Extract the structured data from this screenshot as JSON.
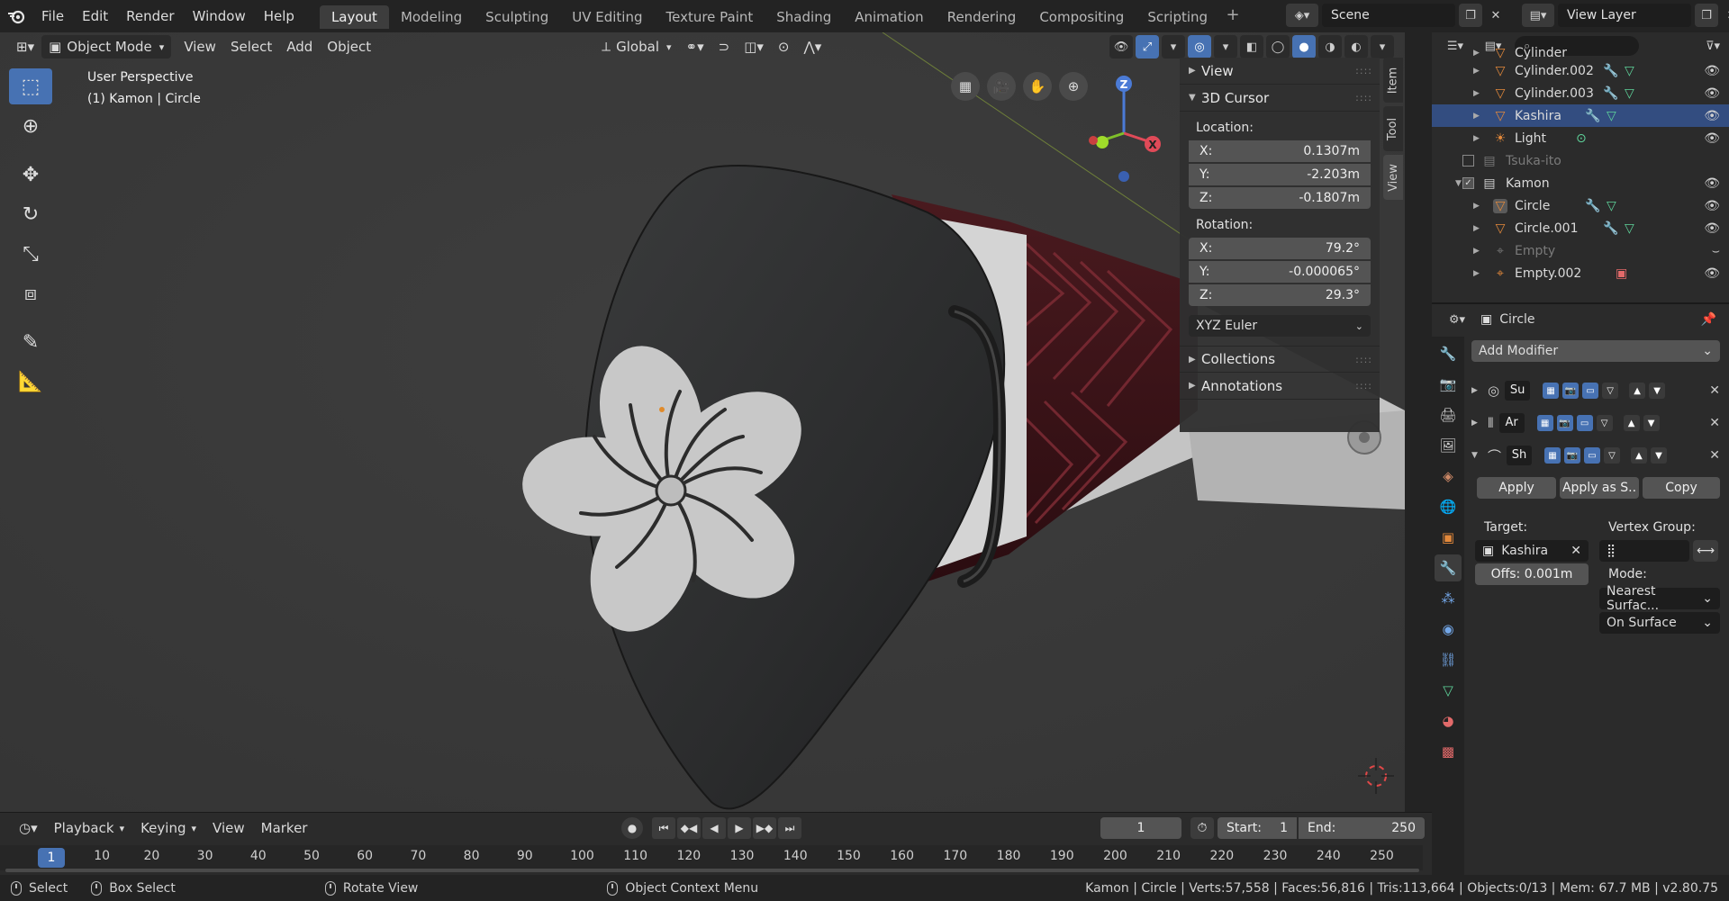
{
  "menu": {
    "items": [
      "File",
      "Edit",
      "Render",
      "Window",
      "Help"
    ]
  },
  "workspaces": {
    "tabs": [
      "Layout",
      "Modeling",
      "Sculpting",
      "UV Editing",
      "Texture Paint",
      "Shading",
      "Animation",
      "Rendering",
      "Compositing",
      "Scripting"
    ],
    "active": "Layout",
    "add_label": "+"
  },
  "scene": {
    "name": "Scene"
  },
  "view_layer": {
    "name": "View Layer"
  },
  "viewport": {
    "mode": "Object Mode",
    "menus": [
      "View",
      "Select",
      "Add",
      "Object"
    ],
    "orientation": "Global",
    "info_line1": "User Perspective",
    "info_line2": "(1) Kamon | Circle"
  },
  "npanel": {
    "view_label": "View",
    "cursor_label": "3D Cursor",
    "location_label": "Location:",
    "location": {
      "x": "0.1307m",
      "y": "-2.203m",
      "z": "-0.1807m"
    },
    "rotation_label": "Rotation:",
    "rotation": {
      "x": "79.2°",
      "y": "-0.000065°",
      "z": "29.3°"
    },
    "rotation_mode": "XYZ Euler",
    "collections_label": "Collections",
    "annotations_label": "Annotations",
    "axis_x": "X:",
    "axis_y": "Y:",
    "axis_z": "Z:",
    "tabs": [
      "Item",
      "Tool",
      "View"
    ]
  },
  "timeline": {
    "menus": [
      "Playback",
      "Keying",
      "View",
      "Marker"
    ],
    "current_frame": "1",
    "start_label": "Start:",
    "start": "1",
    "end_label": "End:",
    "end": "250",
    "ticks": [
      "1",
      "10",
      "20",
      "30",
      "40",
      "50",
      "60",
      "70",
      "80",
      "90",
      "100",
      "110",
      "120",
      "130",
      "140",
      "150",
      "160",
      "170",
      "180",
      "190",
      "200",
      "210",
      "220",
      "230",
      "240",
      "250"
    ]
  },
  "status": {
    "select": "Select",
    "box_select": "Box Select",
    "rotate_view": "Rotate View",
    "context_menu": "Object Context Menu",
    "stats": "Kamon | Circle | Verts:57,558 | Faces:56,816 | Tris:113,664 | Objects:0/13 | Mem: 67.7 MB | v2.80.75"
  },
  "outliner": {
    "search_placeholder": "",
    "rows": [
      {
        "name": "Cylinder",
        "type": "mesh",
        "indent": 2,
        "state": "cut"
      },
      {
        "name": "Cylinder.002",
        "type": "mesh",
        "indent": 2,
        "state": "normal"
      },
      {
        "name": "Cylinder.003",
        "type": "mesh",
        "indent": 2,
        "state": "normal"
      },
      {
        "name": "Kashira",
        "type": "mesh",
        "indent": 2,
        "state": "selected"
      },
      {
        "name": "Light",
        "type": "light",
        "indent": 2,
        "state": "normal"
      },
      {
        "name": "Tsuka-ito",
        "type": "collection",
        "indent": 1,
        "state": "dim"
      },
      {
        "name": "Kamon",
        "type": "collection",
        "indent": 1,
        "state": "normal"
      },
      {
        "name": "Circle",
        "type": "mesh",
        "indent": 2,
        "state": "active"
      },
      {
        "name": "Circle.001",
        "type": "mesh",
        "indent": 2,
        "state": "normal"
      },
      {
        "name": "Empty",
        "type": "empty",
        "indent": 2,
        "state": "dim"
      },
      {
        "name": "Empty.002",
        "type": "empty",
        "indent": 2,
        "state": "normal"
      }
    ]
  },
  "properties": {
    "object_name": "Circle",
    "add_modifier": "Add Modifier",
    "modifiers": [
      {
        "short": "Su",
        "expanded": false
      },
      {
        "short": "Ar",
        "expanded": false
      },
      {
        "short": "Sh",
        "expanded": true
      }
    ],
    "apply": "Apply",
    "apply_as": "Apply as S..",
    "copy": "Copy",
    "target_label": "Target:",
    "target": "Kashira",
    "vertex_group_label": "Vertex Group:",
    "offset": "Offs:  0.001m",
    "mode_label": "Mode:",
    "mode": "Nearest Surfac...",
    "mode2": "On Surface"
  },
  "colors": {
    "accent": "#4772b3",
    "selection": "#334d80",
    "header_bg": "#232323",
    "viewport_bg": "#3a3a3a",
    "panel_bg": "#2b2b2b",
    "orange_object": "#e3893b",
    "green_data": "#5ed39a",
    "blue_wrench": "#73a7e8"
  }
}
